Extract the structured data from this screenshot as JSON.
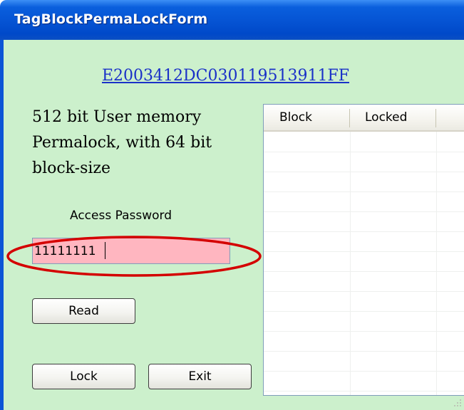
{
  "window": {
    "title": "TagBlockPermaLockForm",
    "title_bar_color": "#0553d3",
    "client_bg_color": "#ccf0cc"
  },
  "tag": {
    "epc": "E2003412DC030119513911FF"
  },
  "description": {
    "lines": [
      "512 bit User memory",
      "Permalock, with 64 bit",
      "block-size"
    ]
  },
  "access_password": {
    "label": "Access Password",
    "value": "11111111",
    "field_color": "#ffb6c0",
    "highlight_color": "#d40000"
  },
  "buttons": {
    "read": "Read",
    "lock": "Lock",
    "exit": "Exit"
  },
  "grid": {
    "columns": [
      "Block",
      "Locked"
    ],
    "rows": []
  },
  "icons": {
    "resize_grip": "resize-grip-icon"
  }
}
